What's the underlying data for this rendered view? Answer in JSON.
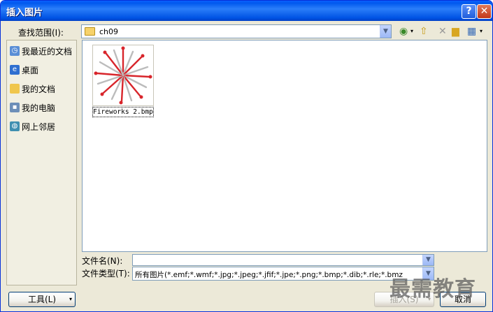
{
  "window": {
    "title": "插入图片"
  },
  "toolbar": {
    "lookin_label": "查找范围(I):",
    "lookin_value": "ch09"
  },
  "places": [
    {
      "label": "我最近的文档",
      "icon": "recent-docs-icon"
    },
    {
      "label": "桌面",
      "icon": "desktop-icon"
    },
    {
      "label": "我的文档",
      "icon": "my-documents-icon"
    },
    {
      "label": "我的电脑",
      "icon": "my-computer-icon"
    },
    {
      "label": "网上邻居",
      "icon": "network-icon"
    }
  ],
  "files": [
    {
      "name": "Fireworks 2.bmp"
    }
  ],
  "fields": {
    "filename_label": "文件名(N):",
    "filename_value": "",
    "filetype_label": "文件类型(T):",
    "filetype_value": "所有图片(*.emf;*.wmf;*.jpg;*.jpeg;*.jfif;*.jpe;*.png;*.bmp;*.dib;*.rle;*.bmz"
  },
  "buttons": {
    "tools": "工具(L)",
    "insert": "插入(S)",
    "cancel": "取消"
  },
  "watermark": "最需教育"
}
